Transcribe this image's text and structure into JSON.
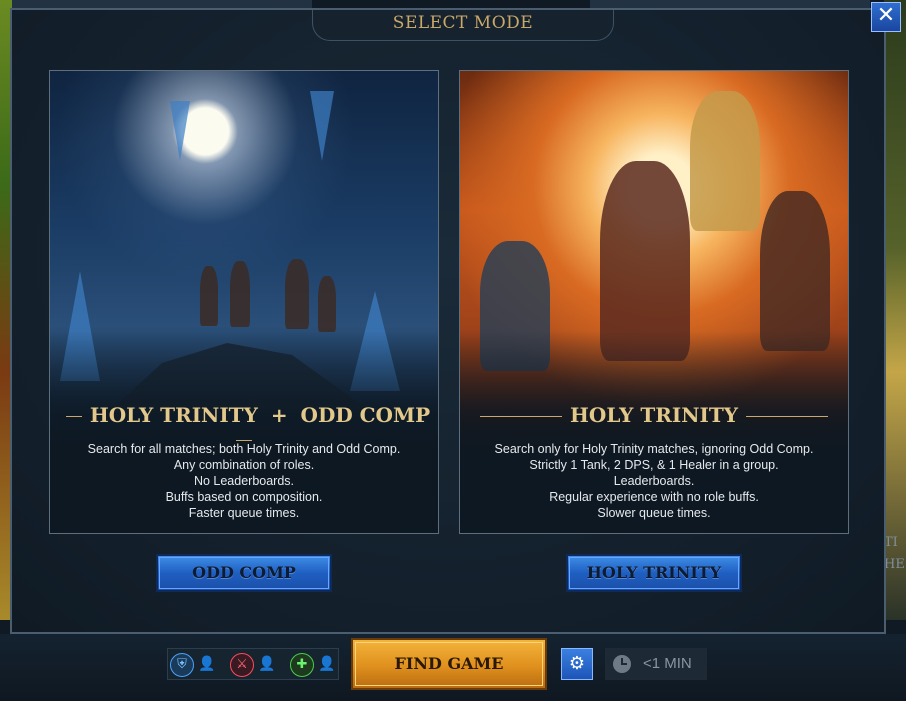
{
  "modal": {
    "title": "SELECT MODE",
    "close_label": "✕"
  },
  "background": {
    "right_partial_text": "TI\nHE"
  },
  "cards": [
    {
      "heading_part1": "HOLY TRINITY",
      "heading_sep": "+",
      "heading_part2": "ODD COMP",
      "description": [
        "Search for all matches; both Holy Trinity and Odd Comp.",
        "Any combination of roles.",
        "No Leaderboards.",
        "Buffs based on composition.",
        "Faster queue times."
      ],
      "button_label": "ODD COMP"
    },
    {
      "heading": "HOLY TRINITY",
      "description": [
        "Search only for Holy Trinity matches, ignoring Odd Comp.",
        "Strictly 1 Tank, 2 DPS, & 1 Healer in a group.",
        "Leaderboards.",
        "Regular experience with no role buffs.",
        "Slower queue times."
      ],
      "button_label": "HOLY TRINITY"
    }
  ],
  "bottom_bar": {
    "roles": [
      {
        "name": "tank",
        "icon": "shield-icon",
        "color": "#4aa2ff"
      },
      {
        "name": "dps",
        "icon": "sword-icon",
        "color": "#ff4a5a"
      },
      {
        "name": "healer",
        "icon": "plus-icon",
        "color": "#4ccc4c"
      }
    ],
    "find_game_label": "FIND GAME",
    "queue_time": "<1 MIN"
  },
  "colors": {
    "gold_text": "#c9a86a",
    "button_blue": "#1f5fc2",
    "find_orange": "#e0901e"
  }
}
